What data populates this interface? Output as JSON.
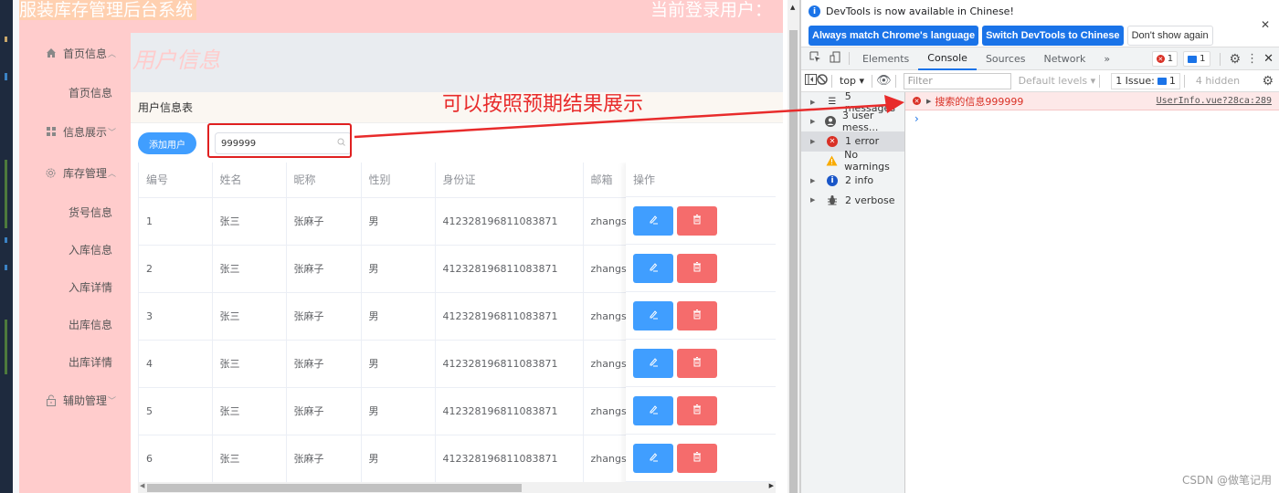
{
  "app": {
    "title": "服装库存管理后台系统",
    "user_label": "当前登录用户：",
    "page_title": "用户信息",
    "card_title": "用户信息表",
    "colors": {
      "background": "#ffcccc",
      "primary": "#409eff",
      "danger": "#f56c6c"
    }
  },
  "sidebar": {
    "items": [
      {
        "label": "首页信息",
        "icon": "home-icon",
        "expanded": true,
        "chevron": "^"
      },
      {
        "label": "首页信息",
        "sub": true
      },
      {
        "label": "信息展示",
        "icon": "grid-icon",
        "expanded": false,
        "chevron": "v"
      },
      {
        "label": "库存管理",
        "icon": "gear-icon",
        "expanded": true,
        "chevron": "^"
      },
      {
        "label": "货号信息",
        "sub": true
      },
      {
        "label": "入库信息",
        "sub": true
      },
      {
        "label": "入库详情",
        "sub": true
      },
      {
        "label": "出库信息",
        "sub": true
      },
      {
        "label": "出库详情",
        "sub": true
      },
      {
        "label": "辅助管理",
        "icon": "lock-icon",
        "expanded": false,
        "chevron": "v"
      }
    ]
  },
  "toolbar": {
    "add_label": "添加用户",
    "search_value": "999999",
    "search_icon": "search-icon"
  },
  "table": {
    "columns": [
      "编号",
      "姓名",
      "昵称",
      "性别",
      "身份证",
      "邮箱"
    ],
    "ops_header": "操作",
    "rows": [
      [
        "1",
        "张三",
        "张麻子",
        "男",
        "412328196811083871",
        "zhangs"
      ],
      [
        "2",
        "张三",
        "张麻子",
        "男",
        "412328196811083871",
        "zhangs"
      ],
      [
        "3",
        "张三",
        "张麻子",
        "男",
        "412328196811083871",
        "zhangs"
      ],
      [
        "4",
        "张三",
        "张麻子",
        "男",
        "412328196811083871",
        "zhangs"
      ],
      [
        "5",
        "张三",
        "张麻子",
        "男",
        "412328196811083871",
        "zhangs"
      ],
      [
        "6",
        "张三",
        "张麻子",
        "男",
        "412328196811083871",
        "zhangs"
      ]
    ]
  },
  "annotation": {
    "text": "可以按照预期结果展示",
    "color": "#e82b2b"
  },
  "devtools": {
    "infobar": {
      "message": "DevTools is now available in Chinese!",
      "buttons": [
        "Always match Chrome's language",
        "Switch DevTools to Chinese",
        "Don't show again"
      ]
    },
    "tabs": [
      "Elements",
      "Console",
      "Sources",
      "Network"
    ],
    "active_tab": "Console",
    "more": "»",
    "error_count": "1",
    "message_count": "1",
    "filter": {
      "context": "top",
      "placeholder": "Filter",
      "levels": "Default levels",
      "issues_label": "1 Issue:",
      "issues_count": "1",
      "hidden": "4 hidden"
    },
    "sidebar": [
      {
        "label": "5 messages",
        "icon": "list-icon"
      },
      {
        "label": "3 user mess...",
        "icon": "user-icon"
      },
      {
        "label": "1 error",
        "icon": "error-icon",
        "selected": true
      },
      {
        "label": "No warnings",
        "icon": "warning-icon"
      },
      {
        "label": "2 info",
        "icon": "info-icon"
      },
      {
        "label": "2 verbose",
        "icon": "bug-icon"
      }
    ],
    "log": {
      "message": "搜索的信息999999",
      "source": "UserInfo.vue?28ca:289"
    }
  },
  "watermark": "CSDN @做笔记用"
}
